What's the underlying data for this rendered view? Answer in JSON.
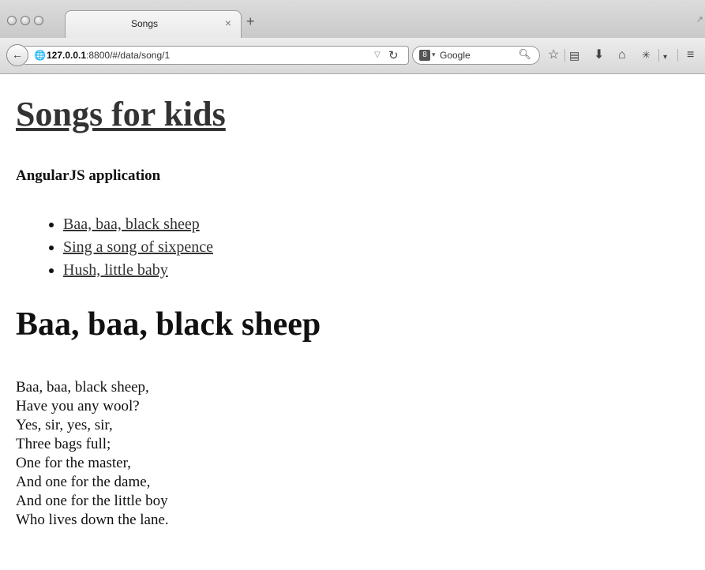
{
  "browser": {
    "tab_title": "Songs",
    "tab_close": "×",
    "new_tab": "+",
    "url_host": "127.0.0.1",
    "url_rest": ":8800/#/data/song/1",
    "search_engine_letter": "8",
    "search_placeholder": "Google"
  },
  "page": {
    "title": "Songs for kids",
    "subtitle": "AngularJS application",
    "songs": [
      {
        "label": "Baa, baa, black sheep"
      },
      {
        "label": "Sing a song of sixpence"
      },
      {
        "label": "Hush, little baby"
      }
    ],
    "current_song": {
      "title": "Baa, baa, black sheep",
      "lyrics": [
        "Baa, baa, black sheep,",
        "Have you any wool?",
        "Yes, sir, yes, sir,",
        "Three bags full;",
        "One for the master,",
        "And one for the dame,",
        "And one for the little boy",
        "Who lives down the lane."
      ]
    }
  },
  "icons": {
    "window_controls": [
      "close-icon",
      "minimize-icon",
      "zoom-icon"
    ],
    "navigation": [
      "back-icon",
      "site-identity-icon",
      "dropdown-icon",
      "reload-icon"
    ],
    "toolbar": [
      "bookmark-star-icon",
      "bookmarks-list-icon",
      "download-icon",
      "home-icon",
      "addon-icon",
      "menu-icon"
    ]
  }
}
